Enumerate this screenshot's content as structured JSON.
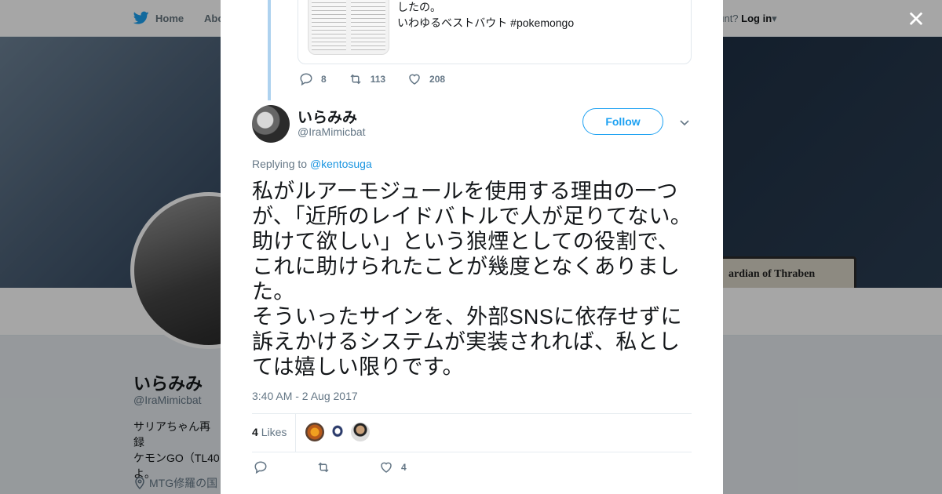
{
  "nav": {
    "home": "Home",
    "about": "Abo",
    "account_prefix": "ccount?",
    "login": "Log in"
  },
  "background_profile": {
    "banner_card_text": "ardian of Thraben",
    "name": "いらみみ",
    "handle": "@IraMimicbat",
    "bio": "サリアちゃん再録\nケモンGO（TL40\nよ。",
    "location": "MTG修羅の国"
  },
  "quoted_tweet": {
    "text": "したの。\nいわゆるベストバウト #pokemongo",
    "replies": "8",
    "retweets": "113",
    "likes": "208"
  },
  "tweet": {
    "name": "いらみみ",
    "handle": "@IraMimicbat",
    "follow_label": "Follow",
    "replying_prefix": "Replying to",
    "replying_to": "@kentosuga",
    "text": "私がルアーモジュールを使用する理由の一つが、「近所のレイドバトルで人が足りてない。助けて欲しい」という狼煙としての役割で、これに助けられたことが幾度となくありました。\nそういったサインを、外部SNSに依存せずに訴えかけるシステムが実装されれば、私としては嬉しい限りです。",
    "timestamp": "3:40 AM - 2 Aug 2017",
    "likes_count": "4",
    "likes_label": "Likes",
    "action_likes": "4"
  },
  "icons": [
    "twitter-bird-icon",
    "close-icon",
    "reply-icon",
    "retweet-icon",
    "heart-icon",
    "chevron-down-icon",
    "location-icon"
  ],
  "colors": {
    "accent": "#1da1f2",
    "thread_line": "#aed2ef",
    "text": "#14171a",
    "muted": "#657786"
  }
}
